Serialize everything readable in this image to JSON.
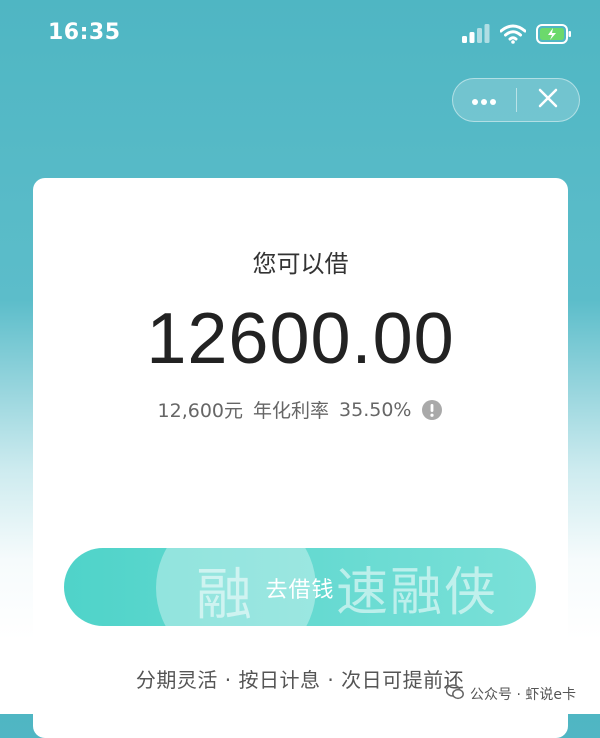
{
  "status_bar": {
    "time": "16:35",
    "icons": [
      "signal-icon",
      "wifi-icon",
      "battery-charging-icon"
    ]
  },
  "capsule": {
    "icons": [
      "more-dots-icon",
      "close-icon"
    ]
  },
  "card": {
    "label": "您可以借",
    "amount": "12600.00",
    "detail_amount": "12,600元",
    "rate_label": "年化利率",
    "rate_value": "35.50%",
    "info_icon": "info-icon"
  },
  "borrow": {
    "label": "去借钱",
    "watermark_char": "融",
    "watermark_text": "速融侠"
  },
  "features": "分期灵活 · 按日计息 · 次日可提前还",
  "source": {
    "icon": "wechat-official-icon",
    "text": "公众号 · 虾说e卡"
  },
  "colors": {
    "header_teal": "#4fb6c3",
    "button_start": "#4fd3c9",
    "button_end": "#7ae0d8"
  }
}
